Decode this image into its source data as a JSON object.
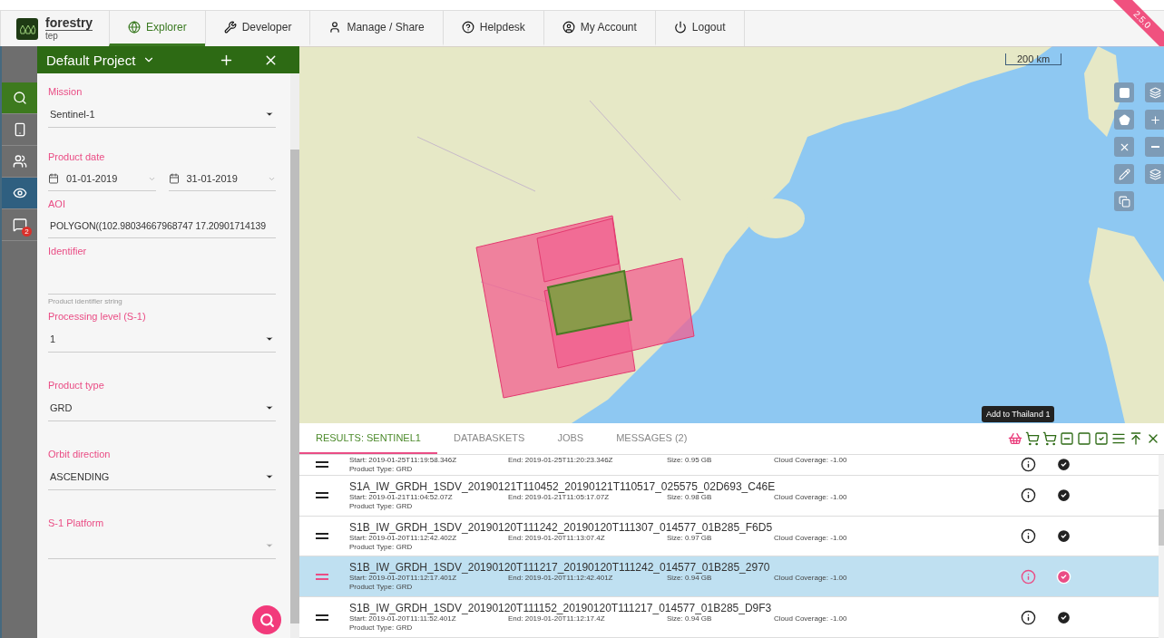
{
  "nav": {
    "logo": {
      "name": "forestry",
      "sub": "tep"
    },
    "tabs": [
      {
        "label": "Explorer",
        "selected": true
      },
      {
        "label": "Developer",
        "selected": false
      },
      {
        "label": "Manage / Share",
        "selected": false
      },
      {
        "label": "Helpdesk",
        "selected": false
      },
      {
        "label": "My Account",
        "selected": false
      },
      {
        "label": "Logout",
        "selected": false
      }
    ],
    "version": "2.5.0"
  },
  "rail": [
    {
      "selected": true,
      "active": false
    },
    {
      "selected": false,
      "active": false
    },
    {
      "selected": false,
      "active": false
    },
    {
      "selected": false,
      "active": true
    },
    {
      "selected": false,
      "active": false,
      "badge": "2"
    }
  ],
  "panel": {
    "title": "Default Project",
    "fields": [
      {
        "kind": "select",
        "label": "Mission",
        "value": "Sentinel-1",
        "disabled": false
      },
      {
        "kind": "daterange",
        "label": "Product date",
        "from": "01-01-2019",
        "to": "31-01-2019"
      },
      {
        "kind": "text",
        "label": "AOI",
        "value": "POLYGON((102.98034667968747 17.20901714139"
      },
      {
        "kind": "text",
        "label": "Identifier",
        "hint": "Product identifier string"
      },
      {
        "kind": "select",
        "label": "Processing level (S-1)",
        "value": "1",
        "disabled": false
      },
      {
        "kind": "select",
        "label": "Product type",
        "value": "GRD",
        "disabled": false
      },
      {
        "kind": "select",
        "label": "Orbit direction",
        "value": "ASCENDING",
        "disabled": false
      },
      {
        "kind": "select",
        "label": "S-1 Platform",
        "disabled": true
      }
    ]
  },
  "map": {
    "scale": "200 km"
  },
  "results": {
    "tabs": [
      {
        "label": "RESULTS: SENTINEL1",
        "selected": true
      },
      {
        "label": "DATABASKETS",
        "selected": false
      },
      {
        "label": "JOBS",
        "selected": false
      },
      {
        "label": "MESSAGES (2)",
        "selected": false
      }
    ],
    "tooltip": "Add to Thailand 1",
    "rows": [
      {
        "start": "Start: 2019-01-25T11:19:58.346Z",
        "end": "End: 2019-01-25T11:20:23.346Z",
        "size": "Size: 0.95 GB",
        "cloud": "Cloud Coverage: -1.00",
        "product_type": "Product Type: GRD",
        "selected": false
      },
      {
        "title": "S1A_IW_GRDH_1SDV_20190121T110452_20190121T110517_025575_02D693_C46E",
        "start": "Start: 2019-01-21T11:04:52.07Z",
        "end": "End: 2019-01-21T11:05:17.07Z",
        "size": "Size: 0.98 GB",
        "cloud": "Cloud Coverage: -1.00",
        "product_type": "Product Type: GRD",
        "selected": false
      },
      {
        "title": "S1B_IW_GRDH_1SDV_20190120T111242_20190120T111307_014577_01B285_F6D5",
        "start": "Start: 2019-01-20T11:12:42.402Z",
        "end": "End: 2019-01-20T11:13:07.4Z",
        "size": "Size: 0.97 GB",
        "cloud": "Cloud Coverage: -1.00",
        "product_type": "Product Type: GRD",
        "selected": false
      },
      {
        "title": "S1B_IW_GRDH_1SDV_20190120T111217_20190120T111242_014577_01B285_2970",
        "start": "Start: 2019-01-20T11:12:17.401Z",
        "end": "End: 2019-01-20T11:12:42.401Z",
        "size": "Size: 0.94 GB",
        "cloud": "Cloud Coverage: -1.00",
        "product_type": "Product Type: GRD",
        "selected": true
      },
      {
        "title": "S1B_IW_GRDH_1SDV_20190120T111152_20190120T111217_014577_01B285_D9F3",
        "start": "Start: 2019-01-20T11:11:52.401Z",
        "end": "End: 2019-01-20T11:12:17.4Z",
        "size": "Size: 0.94 GB",
        "cloud": "Cloud Coverage: -1.00",
        "product_type": "Product Type: GRD",
        "selected": false
      }
    ]
  }
}
